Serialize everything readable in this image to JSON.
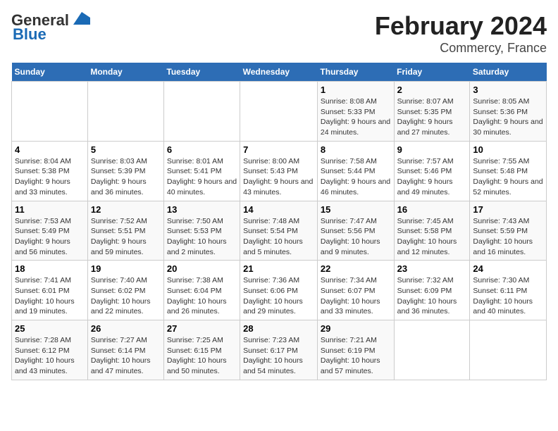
{
  "header": {
    "logo_line1": "General",
    "logo_line2": "Blue",
    "title": "February 2024",
    "subtitle": "Commercy, France"
  },
  "days_of_week": [
    "Sunday",
    "Monday",
    "Tuesday",
    "Wednesday",
    "Thursday",
    "Friday",
    "Saturday"
  ],
  "weeks": [
    [
      {
        "day": "",
        "info": ""
      },
      {
        "day": "",
        "info": ""
      },
      {
        "day": "",
        "info": ""
      },
      {
        "day": "",
        "info": ""
      },
      {
        "day": "1",
        "info": "Sunrise: 8:08 AM\nSunset: 5:33 PM\nDaylight: 9 hours and 24 minutes."
      },
      {
        "day": "2",
        "info": "Sunrise: 8:07 AM\nSunset: 5:35 PM\nDaylight: 9 hours and 27 minutes."
      },
      {
        "day": "3",
        "info": "Sunrise: 8:05 AM\nSunset: 5:36 PM\nDaylight: 9 hours and 30 minutes."
      }
    ],
    [
      {
        "day": "4",
        "info": "Sunrise: 8:04 AM\nSunset: 5:38 PM\nDaylight: 9 hours and 33 minutes."
      },
      {
        "day": "5",
        "info": "Sunrise: 8:03 AM\nSunset: 5:39 PM\nDaylight: 9 hours and 36 minutes."
      },
      {
        "day": "6",
        "info": "Sunrise: 8:01 AM\nSunset: 5:41 PM\nDaylight: 9 hours and 40 minutes."
      },
      {
        "day": "7",
        "info": "Sunrise: 8:00 AM\nSunset: 5:43 PM\nDaylight: 9 hours and 43 minutes."
      },
      {
        "day": "8",
        "info": "Sunrise: 7:58 AM\nSunset: 5:44 PM\nDaylight: 9 hours and 46 minutes."
      },
      {
        "day": "9",
        "info": "Sunrise: 7:57 AM\nSunset: 5:46 PM\nDaylight: 9 hours and 49 minutes."
      },
      {
        "day": "10",
        "info": "Sunrise: 7:55 AM\nSunset: 5:48 PM\nDaylight: 9 hours and 52 minutes."
      }
    ],
    [
      {
        "day": "11",
        "info": "Sunrise: 7:53 AM\nSunset: 5:49 PM\nDaylight: 9 hours and 56 minutes."
      },
      {
        "day": "12",
        "info": "Sunrise: 7:52 AM\nSunset: 5:51 PM\nDaylight: 9 hours and 59 minutes."
      },
      {
        "day": "13",
        "info": "Sunrise: 7:50 AM\nSunset: 5:53 PM\nDaylight: 10 hours and 2 minutes."
      },
      {
        "day": "14",
        "info": "Sunrise: 7:48 AM\nSunset: 5:54 PM\nDaylight: 10 hours and 5 minutes."
      },
      {
        "day": "15",
        "info": "Sunrise: 7:47 AM\nSunset: 5:56 PM\nDaylight: 10 hours and 9 minutes."
      },
      {
        "day": "16",
        "info": "Sunrise: 7:45 AM\nSunset: 5:58 PM\nDaylight: 10 hours and 12 minutes."
      },
      {
        "day": "17",
        "info": "Sunrise: 7:43 AM\nSunset: 5:59 PM\nDaylight: 10 hours and 16 minutes."
      }
    ],
    [
      {
        "day": "18",
        "info": "Sunrise: 7:41 AM\nSunset: 6:01 PM\nDaylight: 10 hours and 19 minutes."
      },
      {
        "day": "19",
        "info": "Sunrise: 7:40 AM\nSunset: 6:02 PM\nDaylight: 10 hours and 22 minutes."
      },
      {
        "day": "20",
        "info": "Sunrise: 7:38 AM\nSunset: 6:04 PM\nDaylight: 10 hours and 26 minutes."
      },
      {
        "day": "21",
        "info": "Sunrise: 7:36 AM\nSunset: 6:06 PM\nDaylight: 10 hours and 29 minutes."
      },
      {
        "day": "22",
        "info": "Sunrise: 7:34 AM\nSunset: 6:07 PM\nDaylight: 10 hours and 33 minutes."
      },
      {
        "day": "23",
        "info": "Sunrise: 7:32 AM\nSunset: 6:09 PM\nDaylight: 10 hours and 36 minutes."
      },
      {
        "day": "24",
        "info": "Sunrise: 7:30 AM\nSunset: 6:11 PM\nDaylight: 10 hours and 40 minutes."
      }
    ],
    [
      {
        "day": "25",
        "info": "Sunrise: 7:28 AM\nSunset: 6:12 PM\nDaylight: 10 hours and 43 minutes."
      },
      {
        "day": "26",
        "info": "Sunrise: 7:27 AM\nSunset: 6:14 PM\nDaylight: 10 hours and 47 minutes."
      },
      {
        "day": "27",
        "info": "Sunrise: 7:25 AM\nSunset: 6:15 PM\nDaylight: 10 hours and 50 minutes."
      },
      {
        "day": "28",
        "info": "Sunrise: 7:23 AM\nSunset: 6:17 PM\nDaylight: 10 hours and 54 minutes."
      },
      {
        "day": "29",
        "info": "Sunrise: 7:21 AM\nSunset: 6:19 PM\nDaylight: 10 hours and 57 minutes."
      },
      {
        "day": "",
        "info": ""
      },
      {
        "day": "",
        "info": ""
      }
    ]
  ]
}
